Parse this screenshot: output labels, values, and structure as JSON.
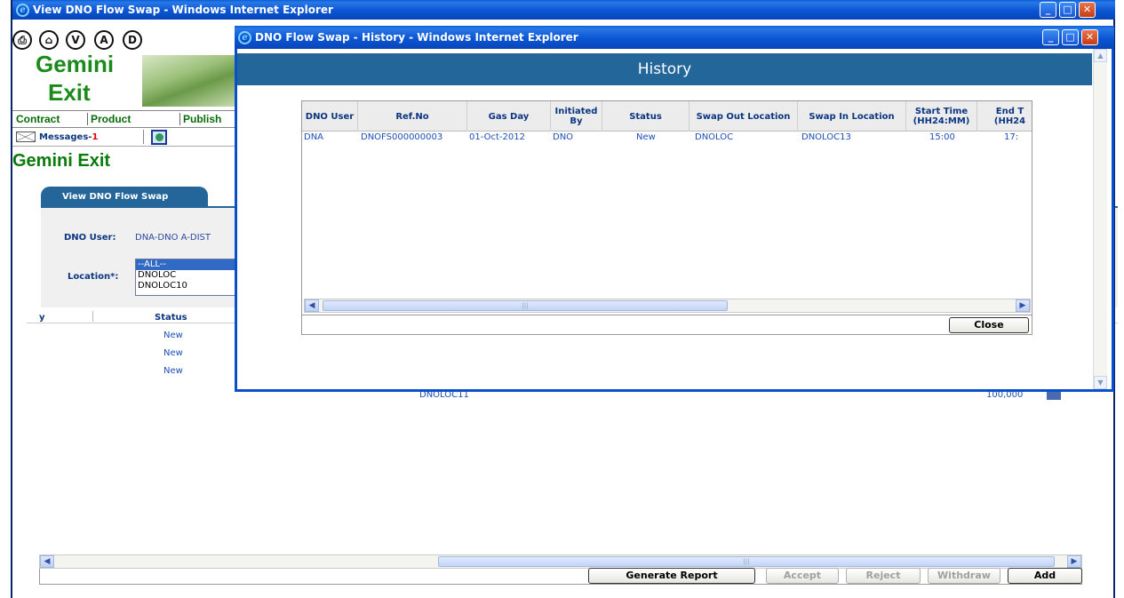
{
  "main_window": {
    "title": "View DNO Flow Swap - Windows Internet Explorer",
    "circle_buttons": [
      "V",
      "A",
      "D"
    ],
    "brand": {
      "line1": "Gemini",
      "line2": "Exit"
    },
    "nav": [
      "Contract",
      "Product",
      "Publish"
    ],
    "messages_label": "Messages-",
    "messages_count": "1",
    "page_title": "Gemini Exit",
    "tab_label": "View DNO Flow Swap",
    "dno_user_label": "DNO User:",
    "dno_user_value": "DNA-DNO A-DIST",
    "location_label": "Location*:",
    "location_options": [
      "--ALL--",
      "DNOLOC",
      "DNOLOC10"
    ],
    "grid_header_partial": "y",
    "grid_header_status": "Status",
    "status_values": [
      "New",
      "New",
      "New"
    ],
    "partial_row_location": "DNOLOC11",
    "partial_row_value": "100,000",
    "buttons": {
      "generate_report": "Generate Report",
      "accept": "Accept",
      "reject": "Reject",
      "withdraw": "Withdraw",
      "add": "Add"
    }
  },
  "popup": {
    "title": "DNO Flow Swap - History - Windows Internet Explorer",
    "banner": "History",
    "columns": {
      "dno_user": "DNO User",
      "ref_no": "Ref.No",
      "gas_day": "Gas Day",
      "initiated_by": "Initiated By",
      "status": "Status",
      "swap_out_location": "Swap Out Location",
      "swap_in_location": "Swap In Location",
      "start_time": "Start Time (HH24:MM)",
      "end_time": "End T (HH24"
    },
    "rows": [
      {
        "dno_user": "DNA",
        "ref_no": "DNOFS000000003",
        "gas_day": "01-Oct-2012",
        "initiated_by": "DNO",
        "status": "New",
        "swap_out_location": "DNOLOC",
        "swap_in_location": "DNOLOC13",
        "start_time": "15:00",
        "end_time": "17:"
      }
    ],
    "close_button": "Close"
  },
  "colors": {
    "xp_title_blue": "#0b55d4",
    "banner_blue": "#23679a",
    "brand_green": "#1a8a1a",
    "header_text": "#0b3680"
  }
}
